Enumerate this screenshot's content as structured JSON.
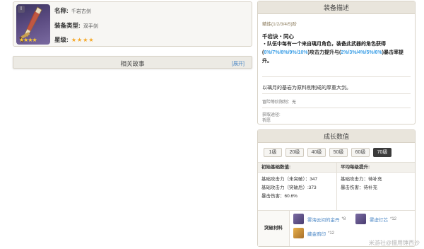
{
  "weapon": {
    "rarity_badge": "I",
    "stars_on_thumb": "★★★★",
    "name_label": "名称:",
    "name_value": "千岩古剑",
    "type_label": "装备类型:",
    "type_value": "双手剑",
    "rank_label": "星级:",
    "rank_stars": "★★★★",
    "rank_value": 4
  },
  "story": {
    "title": "相关故事",
    "expand_label": "[展开]"
  },
  "description": {
    "header": "装备描述",
    "refine": "精炼(1/2/3/4/5)阶",
    "passive_title": "千岩诀・同心",
    "passive_parts": {
      "p1": "・队伍中每有一个来自璃月角色，装备此武器的角色获得(",
      "v1": "6%/7%/8%/9%/10%",
      "p2": ")攻击力提升与(",
      "v2": "2%/3%/4%/5%/6%",
      "p3": ")暴击率提升。"
    },
    "flavor": "以璃月的基岩为原料削制成的厚重大剑。",
    "unlock": "冒险等阶限制：无",
    "source_label": "获取途径:",
    "source_value": "祈愿"
  },
  "growth": {
    "header": "成长数值",
    "levels": [
      "1级",
      "20级",
      "40级",
      "50级",
      "60级",
      "70级"
    ],
    "active_level": "70级",
    "base_header": "初始基础数值:",
    "ascend_header": "平均每级提升:",
    "base_stats": [
      "基础攻击力（未突破）：347",
      "基础攻击力（突破后）:373",
      "暴击伤害：60.6%"
    ],
    "ascend_stats": [
      "基础攻击力：待补充",
      "暴击伤害：待补充"
    ],
    "materials_label": "突破材料",
    "materials": [
      {
        "name": "雾海云间的金丹",
        "count": "*8"
      },
      {
        "name": "雾虚灯芯",
        "count": "*12"
      },
      {
        "name": "藏金鸦印",
        "count": "*12"
      }
    ]
  },
  "watermark": "米游社@擅用锤西沙",
  "colors": {
    "accent_blue": "#3a9ee6",
    "link_blue": "#4a86c5",
    "star_gold": "#f5a623",
    "panel_bg": "#e9e5dc"
  }
}
